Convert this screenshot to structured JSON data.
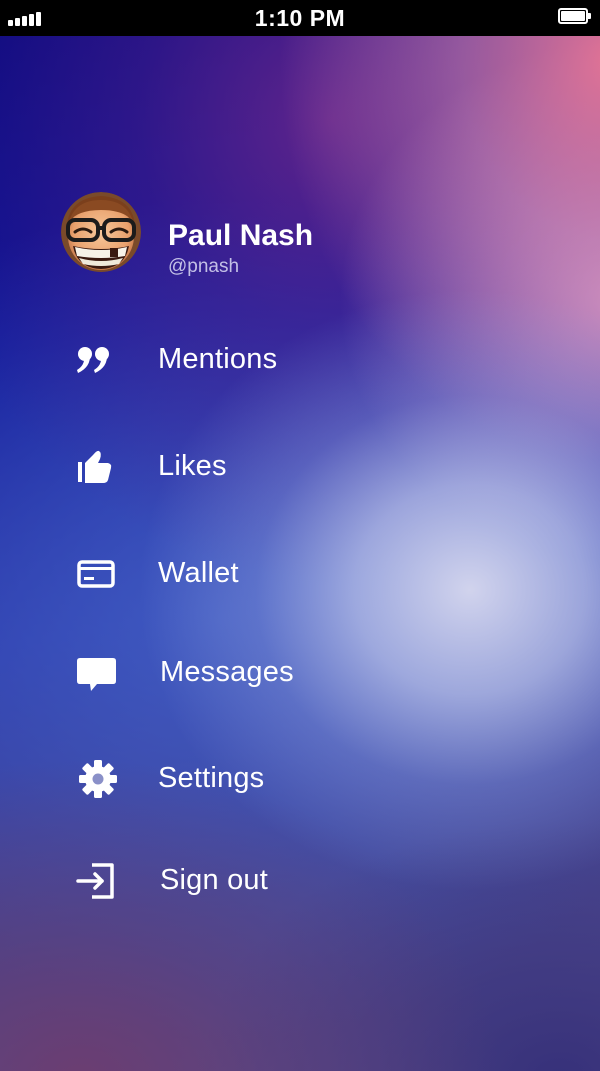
{
  "status_bar": {
    "time": "1:10 PM",
    "signal_icon": "signal-bars-icon",
    "battery_icon": "battery-icon"
  },
  "profile": {
    "name": "Paul Nash",
    "handle": "@pnash",
    "avatar_icon": "avatar"
  },
  "menu": {
    "items": [
      {
        "id": "mentions",
        "label": "Mentions",
        "icon": "quote-icon"
      },
      {
        "id": "likes",
        "label": "Likes",
        "icon": "thumbs-up-icon"
      },
      {
        "id": "wallet",
        "label": "Wallet",
        "icon": "credit-card-icon"
      },
      {
        "id": "messages",
        "label": "Messages",
        "icon": "speech-bubble-icon"
      },
      {
        "id": "settings",
        "label": "Settings",
        "icon": "gear-icon"
      },
      {
        "id": "signout",
        "label": "Sign out",
        "icon": "sign-in-arrow-icon"
      }
    ]
  },
  "colors": {
    "background_deep": "#06087e",
    "background_glow": "#d4d6ee",
    "accent_pink": "#eb7896",
    "text": "#ffffff"
  }
}
